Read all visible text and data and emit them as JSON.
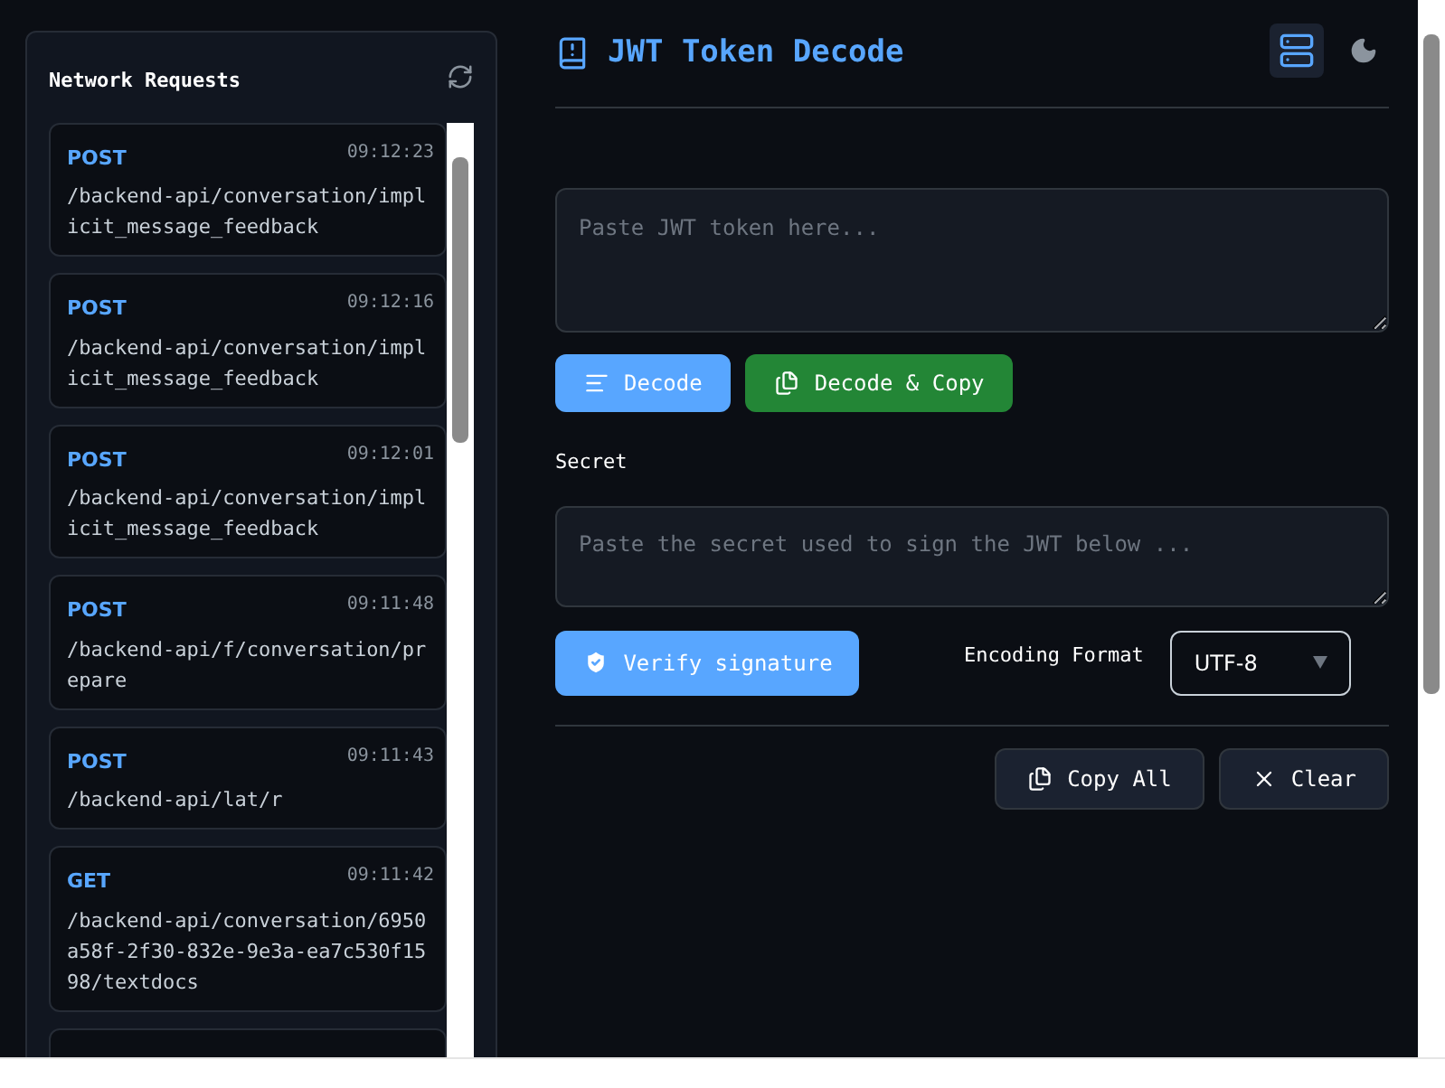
{
  "sidebar": {
    "title": "Network Requests",
    "requests": [
      {
        "method": "POST",
        "time": "09:12:23",
        "path": "/backend-api/conversation/implicit_message_feedback"
      },
      {
        "method": "POST",
        "time": "09:12:16",
        "path": "/backend-api/conversation/implicit_message_feedback"
      },
      {
        "method": "POST",
        "time": "09:12:01",
        "path": "/backend-api/conversation/implicit_message_feedback"
      },
      {
        "method": "POST",
        "time": "09:11:48",
        "path": "/backend-api/f/conversation/prepare"
      },
      {
        "method": "POST",
        "time": "09:11:43",
        "path": "/backend-api/lat/r"
      },
      {
        "method": "GET",
        "time": "09:11:42",
        "path": "/backend-api/conversation/6950a58f-2f30-832e-9e3a-ea7c530f1598/textdocs"
      }
    ]
  },
  "header": {
    "title": "JWT Token Decode"
  },
  "token_field": {
    "placeholder": "Paste JWT token here..."
  },
  "decode_buttons": [
    "Decode",
    "Decode & Copy"
  ],
  "secret": {
    "label": "Secret",
    "placeholder": "Paste the secret used to sign the JWT below ...",
    "verify_button": "Verify signature",
    "encoding_label": "Encoding Format",
    "encoding_value": "UTF-8"
  },
  "footer_buttons": [
    "Copy All",
    "Clear"
  ]
}
